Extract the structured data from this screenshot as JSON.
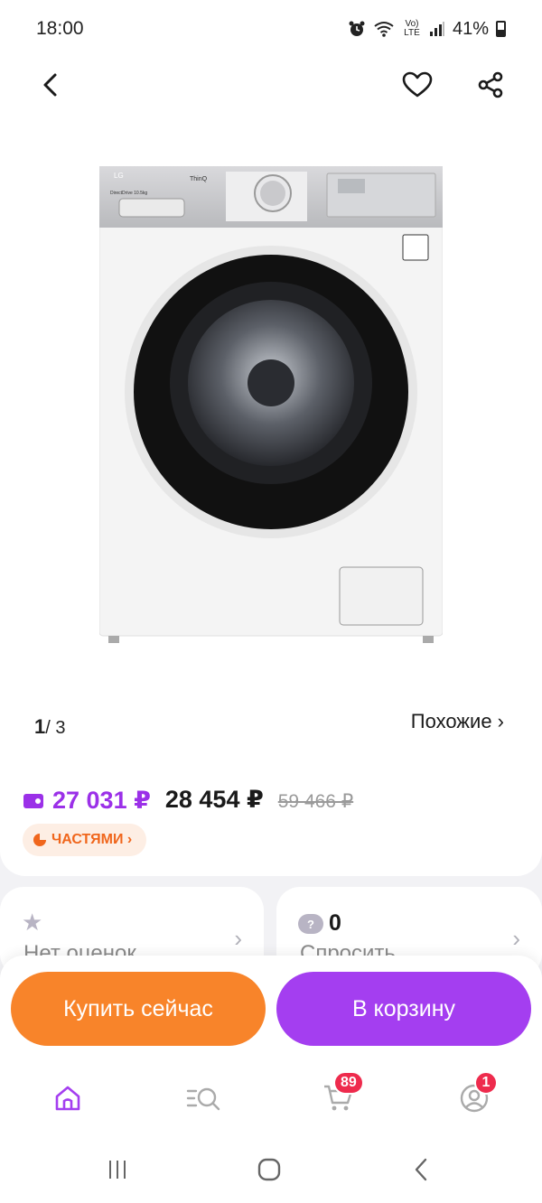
{
  "status_bar": {
    "time": "18:00",
    "network": "Vo) LTE",
    "battery": "41%"
  },
  "nav": {
    "back_icon": "chevron-left-icon",
    "favorite_icon": "heart-icon",
    "share_icon": "share-icon"
  },
  "gallery": {
    "current": "1",
    "separator": "/",
    "total": "3",
    "similar_label": "Похожие ›",
    "image_brand": "LG",
    "image_model": "ThinQ",
    "image_capacity": "DirectDrive 10.5kg"
  },
  "price": {
    "card_price": "27 031 ₽",
    "price": "28 454 ₽",
    "old_price": "59 466 ₽",
    "card_color": "#9b30e8"
  },
  "installments": {
    "label": "ЧАСТЯМИ ›",
    "color": "#f0661c"
  },
  "rating_card": {
    "label": "Нет оценок"
  },
  "questions_card": {
    "count": "0",
    "label": "Спросить"
  },
  "actions": {
    "buy_now": "Купить сейчас",
    "add_to_cart": "В корзину",
    "buy_color": "#f8842a",
    "cart_color": "#a43ef0"
  },
  "tab_bar": {
    "home_icon": "home-icon",
    "catalog_icon": "catalog-search-icon",
    "cart_icon": "cart-icon",
    "cart_badge": "89",
    "profile_icon": "profile-icon",
    "profile_badge": "1"
  },
  "system_nav": {
    "recent_icon": "recent-apps-icon",
    "home_icon": "home-circle-icon",
    "back_icon": "back-icon"
  }
}
